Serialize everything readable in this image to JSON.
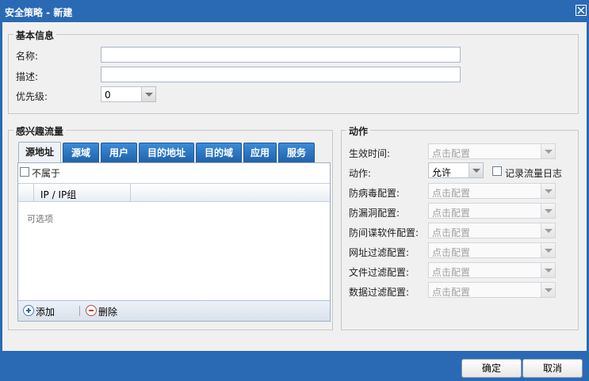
{
  "window": {
    "title": "安全策略 - 新建"
  },
  "basic": {
    "legend": "基本信息",
    "name_label": "名称:",
    "name_value": "",
    "desc_label": "描述:",
    "desc_value": "",
    "priority_label": "优先级:",
    "priority_value": "0"
  },
  "traffic": {
    "legend": "感兴趣流量",
    "tabs": [
      "源地址",
      "源域",
      "用户",
      "目的地址",
      "目的域",
      "应用",
      "服务"
    ],
    "active_tab": "源地址",
    "not_belong_label": "不属于",
    "column_header": "IP / IP组",
    "empty_text": "可选项",
    "add_label": "添加",
    "delete_label": "删除"
  },
  "action": {
    "legend": "动作",
    "effective_time_label": "生效时间:",
    "effective_time_placeholder": "点击配置",
    "action_label": "动作:",
    "action_value": "允许",
    "log_label": "记录流量日志",
    "antivirus_label": "防病毒配置:",
    "vuln_label": "防漏洞配置:",
    "spyware_label": "防间谍软件配置:",
    "url_label": "网址过滤配置:",
    "file_label": "文件过滤配置:",
    "data_label": "数据过滤配置:",
    "placeholder": "点击配置"
  },
  "footer": {
    "ok_label": "确定",
    "cancel_label": "取消"
  },
  "colors": {
    "titlebar": "#2a6ab5",
    "tab": "#2a72c4",
    "body": "#f0f0f0"
  }
}
